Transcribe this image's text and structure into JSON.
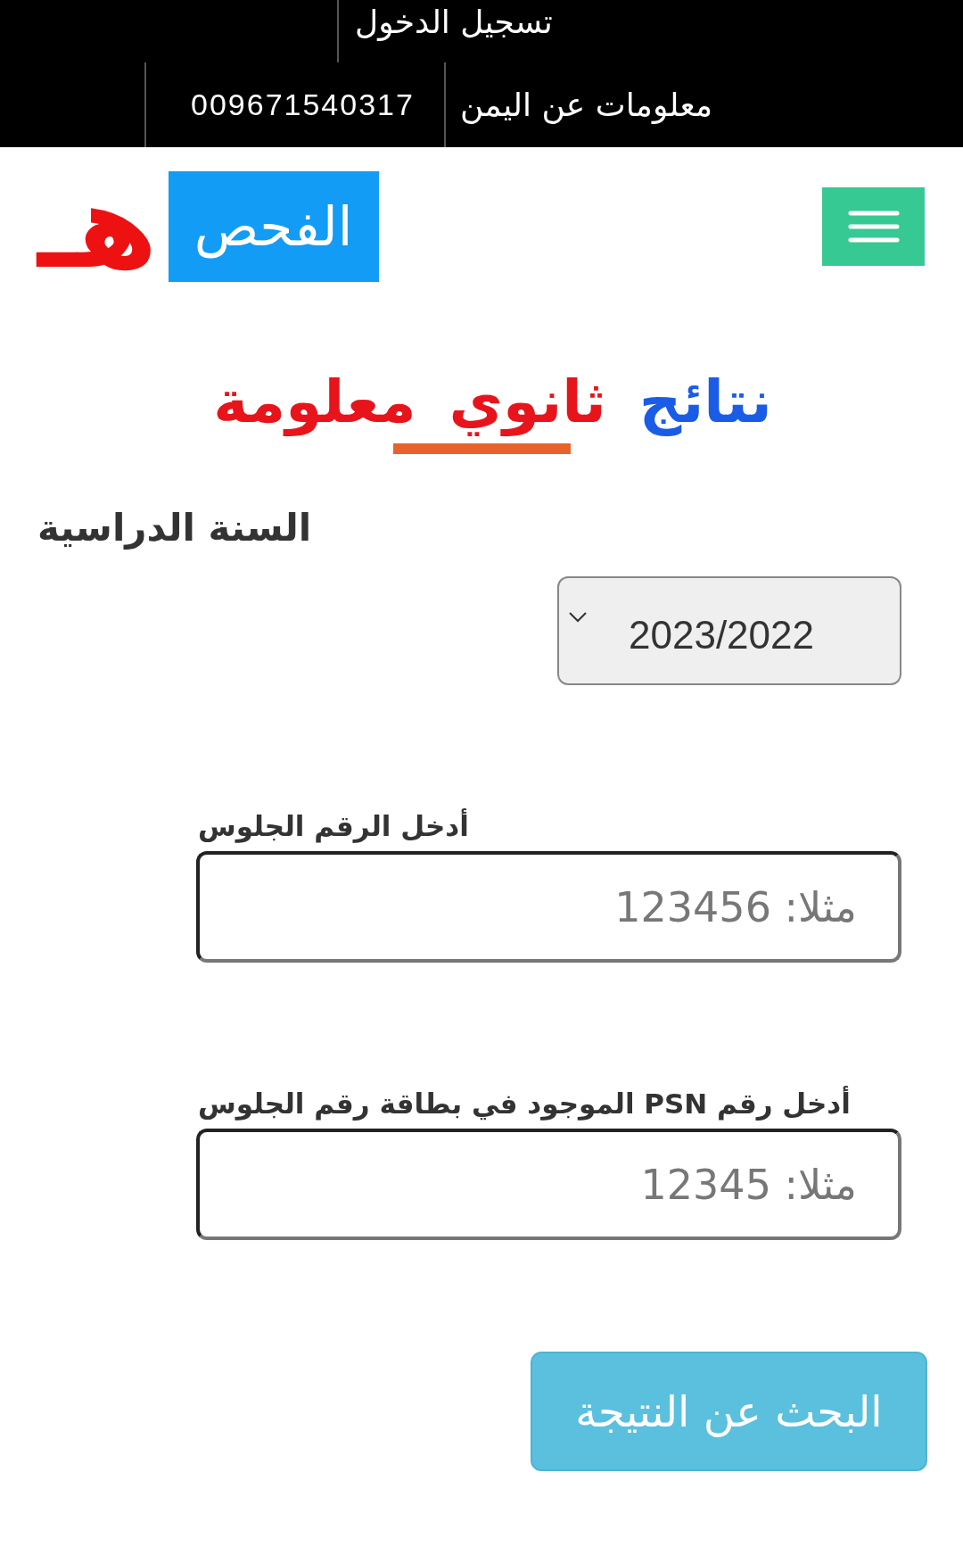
{
  "top_bar": {
    "login_link": "تسجيل الدخول",
    "phone": "009671540317",
    "info_link": "معلومات عن اليمن"
  },
  "header": {
    "logo_mark": "هـ",
    "logo_text": "الفحص"
  },
  "title": [
    {
      "text": "نتائج",
      "color": "#1a5ce6"
    },
    {
      "text": "ثانوي معلومة",
      "color": "#e8141c"
    }
  ],
  "year": {
    "label": "السنة الدراسية",
    "value": "2023/2022"
  },
  "fields": [
    {
      "label": "أدخل الرقم الجلوس",
      "placeholder": "مثلا: 123456"
    },
    {
      "label": "أدخل رقم PSN الموجود في بطاقة رقم الجلوس",
      "placeholder": "مثلا: 12345"
    }
  ],
  "submit": {
    "label": "البحث عن النتيجة"
  }
}
